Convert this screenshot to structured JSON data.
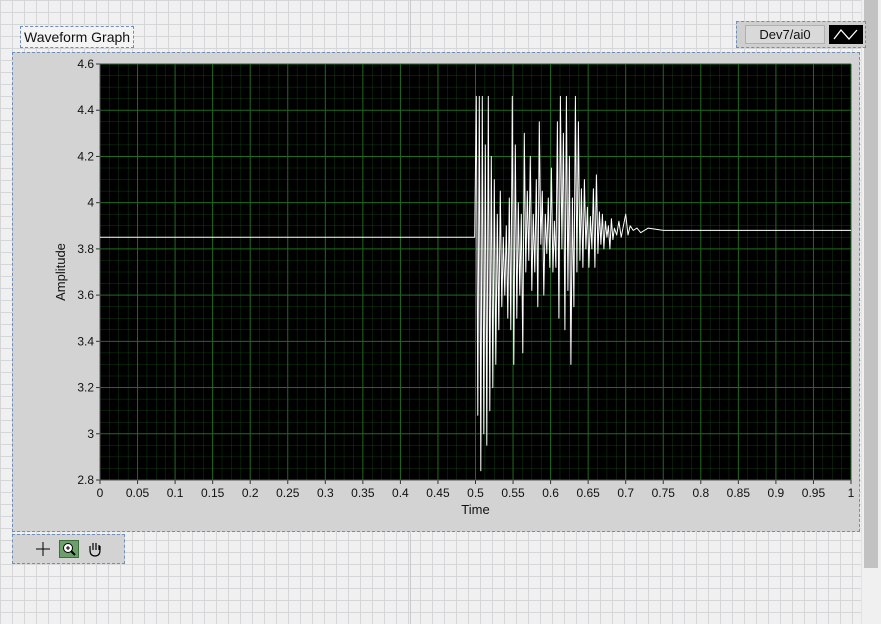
{
  "graph": {
    "label": "Waveform Graph",
    "legend_name": "Dev7/ai0"
  },
  "palette": {
    "tools": [
      "cursor-tool",
      "zoom-tool",
      "pan-tool"
    ]
  },
  "colors": {
    "plot_background": "#000000",
    "grid": "#1f6b1f",
    "trace": "#ffffff",
    "frame": "#d3d3d3"
  },
  "chart_data": {
    "type": "line",
    "title": "",
    "xlabel": "Time",
    "ylabel": "Amplitude",
    "xlim": [
      0,
      1
    ],
    "ylim": [
      2.8,
      4.6
    ],
    "x_ticks": [
      "0",
      "0.05",
      "0.1",
      "0.15",
      "0.2",
      "0.25",
      "0.3",
      "0.35",
      "0.4",
      "0.45",
      "0.5",
      "0.55",
      "0.6",
      "0.65",
      "0.7",
      "0.75",
      "0.8",
      "0.85",
      "0.9",
      "0.95",
      "1"
    ],
    "y_ticks": [
      "2.8",
      "3",
      "3.2",
      "3.4",
      "3.6",
      "3.8",
      "4",
      "4.2",
      "4.4",
      "4.6"
    ],
    "grid": true,
    "series": [
      {
        "name": "Dev7/ai0",
        "x": [
          0,
          0.1,
          0.2,
          0.3,
          0.4,
          0.497,
          0.499,
          0.501,
          0.503,
          0.505,
          0.507,
          0.509,
          0.511,
          0.513,
          0.515,
          0.517,
          0.519,
          0.521,
          0.523,
          0.525,
          0.527,
          0.529,
          0.531,
          0.533,
          0.535,
          0.537,
          0.539,
          0.541,
          0.543,
          0.545,
          0.547,
          0.549,
          0.551,
          0.553,
          0.555,
          0.557,
          0.559,
          0.561,
          0.563,
          0.565,
          0.567,
          0.569,
          0.571,
          0.573,
          0.575,
          0.577,
          0.579,
          0.581,
          0.583,
          0.585,
          0.587,
          0.589,
          0.591,
          0.593,
          0.595,
          0.597,
          0.599,
          0.601,
          0.603,
          0.605,
          0.607,
          0.609,
          0.611,
          0.613,
          0.615,
          0.617,
          0.619,
          0.621,
          0.623,
          0.625,
          0.627,
          0.629,
          0.631,
          0.633,
          0.635,
          0.637,
          0.639,
          0.641,
          0.643,
          0.645,
          0.647,
          0.649,
          0.651,
          0.653,
          0.655,
          0.657,
          0.659,
          0.661,
          0.663,
          0.665,
          0.667,
          0.669,
          0.671,
          0.673,
          0.675,
          0.677,
          0.679,
          0.681,
          0.683,
          0.685,
          0.688,
          0.691,
          0.694,
          0.697,
          0.7,
          0.703,
          0.706,
          0.71,
          0.715,
          0.72,
          0.73,
          0.75,
          0.8,
          0.85,
          0.9,
          0.95,
          1.0
        ],
        "y": [
          3.85,
          3.85,
          3.85,
          3.85,
          3.85,
          3.85,
          3.85,
          4.46,
          3.08,
          4.46,
          2.84,
          4.46,
          3.0,
          4.25,
          2.95,
          4.46,
          3.1,
          4.2,
          3.2,
          4.1,
          3.3,
          3.95,
          3.45,
          4.05,
          3.55,
          3.85,
          3.6,
          3.9,
          3.5,
          4.02,
          3.45,
          4.46,
          3.3,
          4.25,
          3.5,
          4.0,
          3.6,
          3.95,
          3.35,
          4.3,
          3.7,
          4.05,
          3.75,
          4.2,
          3.62,
          3.95,
          3.7,
          4.1,
          3.55,
          4.35,
          3.82,
          4.05,
          3.6,
          3.95,
          3.78,
          4.02,
          3.72,
          4.15,
          3.7,
          3.92,
          3.72,
          4.35,
          3.5,
          4.46,
          3.8,
          4.3,
          3.45,
          4.46,
          3.62,
          4.2,
          3.3,
          4.02,
          3.55,
          4.46,
          3.7,
          4.35,
          3.75,
          4.06,
          3.72,
          4.1,
          3.8,
          3.98,
          3.72,
          3.94,
          3.8,
          4.06,
          3.72,
          4.12,
          3.78,
          3.96,
          3.82,
          3.95,
          3.8,
          3.92,
          3.85,
          3.9,
          3.8,
          3.93,
          3.84,
          3.89,
          3.86,
          3.92,
          3.85,
          3.9,
          3.95,
          3.86,
          3.9,
          3.88,
          3.89,
          3.87,
          3.89,
          3.88,
          3.88,
          3.88,
          3.88,
          3.88,
          3.88
        ]
      }
    ]
  }
}
